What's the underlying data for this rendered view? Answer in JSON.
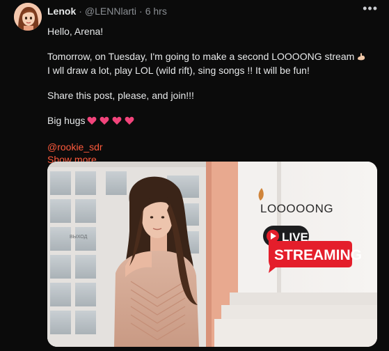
{
  "author": {
    "name": "Lenok",
    "handle": "@LENNlarti",
    "time": "6 hrs"
  },
  "menu_icon": "more-horizontal-icon",
  "post": {
    "line1": "Hello, Arena!",
    "line2": "Tomorrow, on Tuesday, I'm going to make a second LOOOONG stream",
    "line3": "I wll draw a lot, play LOL (wild rift), sing songs !! It will be fun!",
    "line4": "Share this post, please, and join!!!",
    "line5": "Big hugs",
    "mention": "@rookie_sdr",
    "show_more": "Show more"
  },
  "media": {
    "sign": "ВЫХОД",
    "headline": "LOOOOONG",
    "badge_live": "LIVE",
    "badge_streaming": "STREAMING"
  },
  "colors": {
    "background": "#0b0b0b",
    "link": "#ff5a3c",
    "live_red": "#e41e2b"
  }
}
